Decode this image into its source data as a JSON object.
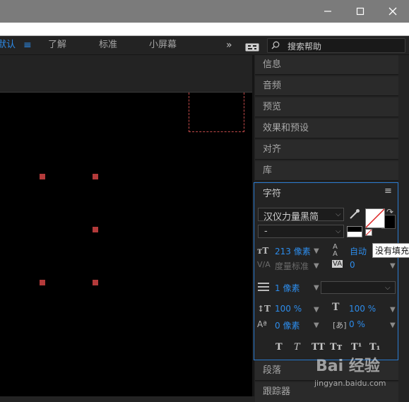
{
  "workspace": {
    "items": [
      "默认",
      "了解",
      "标准",
      "小屏幕"
    ],
    "overflow_icon": "chevron-double-right-icon",
    "search_placeholder": "搜索帮助"
  },
  "panels": {
    "items": [
      "信息",
      "音频",
      "预览",
      "效果和预设",
      "对齐",
      "库"
    ],
    "bottom_items": [
      "段落",
      "跟踪器"
    ]
  },
  "character": {
    "title": "字符",
    "font_family": "汉仪力量黑简",
    "font_style": "-",
    "font_size": "213 像素",
    "leading": "自动",
    "kerning": "度量标准",
    "tracking": "0",
    "stroke_width": "1 像素",
    "stroke_type": "",
    "vertical_scale": "100 %",
    "horizontal_scale": "100 %",
    "baseline_shift": "0 像素",
    "tsume": "0 %",
    "format_buttons": [
      "T",
      "T",
      "TT",
      "Tт",
      "T¹",
      "T₁"
    ]
  },
  "tooltip": "没有填充",
  "watermark": {
    "brand": "Bai 经验",
    "url": "jingyan.baidu.com"
  },
  "colors": {
    "accent_blue": "#2d8ceb",
    "panel_border": "#2c7dd2",
    "handle_red": "#b33a3a"
  }
}
